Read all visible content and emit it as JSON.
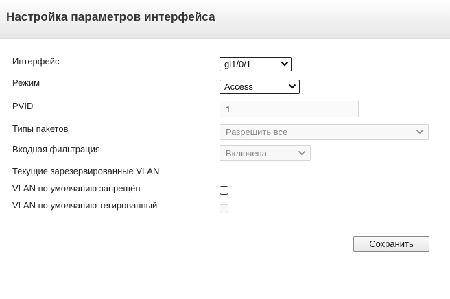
{
  "header": {
    "title": "Настройка параметров интерфейса"
  },
  "form": {
    "interface": {
      "label": "Интерфейс",
      "value": "gi1/0/1"
    },
    "mode": {
      "label": "Режим",
      "value": "Access"
    },
    "pvid": {
      "label": "PVID",
      "value": "1"
    },
    "packet_types": {
      "label": "Типы пакетов",
      "value": "Разрешить все"
    },
    "ingress_filtering": {
      "label": "Входная фильтрация",
      "value": "Включена"
    },
    "reserved_vlan": {
      "label": "Текущие зарезервированные VLAN"
    },
    "default_vlan_forbidden": {
      "label": "VLAN по умолчанию запрещён",
      "checked": false
    },
    "default_vlan_tagged": {
      "label": "VLAN по умолчанию тегированный",
      "checked": false,
      "disabled": true
    }
  },
  "actions": {
    "save_label": "Сохранить"
  }
}
